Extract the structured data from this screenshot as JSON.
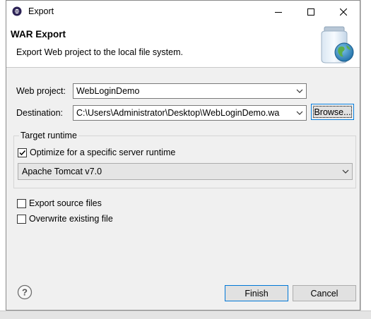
{
  "window": {
    "title": "Export"
  },
  "banner": {
    "title": "WAR Export",
    "description": "Export Web project to the local file system."
  },
  "form": {
    "web_project_label": "Web project:",
    "web_project_value": "WebLoginDemo",
    "destination_label": "Destination:",
    "destination_value": "C:\\Users\\Administrator\\Desktop\\WebLoginDemo.wa",
    "browse_label": "Browse..."
  },
  "target_runtime": {
    "group_title": "Target runtime",
    "optimize_label": "Optimize for a specific server runtime",
    "optimize_checked": true,
    "runtime_value": "Apache Tomcat v7.0"
  },
  "options": {
    "export_source_label": "Export source files",
    "export_source_checked": false,
    "overwrite_label": "Overwrite existing file",
    "overwrite_checked": false
  },
  "footer": {
    "finish_label": "Finish",
    "cancel_label": "Cancel"
  },
  "icons": {
    "app": "eclipse-icon",
    "banner": "jar-globe-icon",
    "help": "help-icon"
  },
  "colors": {
    "accent": "#0078d7",
    "dialog_bg": "#f0f0f0",
    "banner_bg": "#ffffff"
  }
}
